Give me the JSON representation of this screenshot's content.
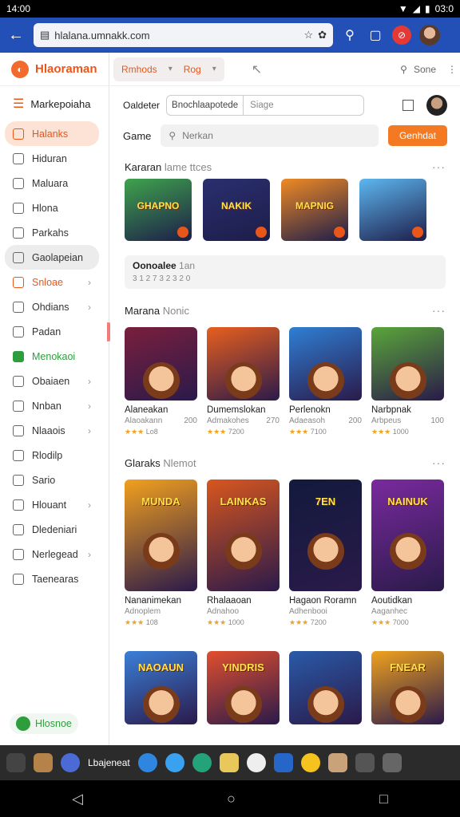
{
  "status": {
    "time": "14:00",
    "clock_right": "03:0"
  },
  "browser": {
    "url": "hlalana.umnakk.com"
  },
  "sidebar": {
    "brand": "Hlaoraman",
    "menu_label": "Markepoiaha",
    "items": [
      {
        "label": "Halanks",
        "style": "active"
      },
      {
        "label": "Hiduran",
        "style": ""
      },
      {
        "label": "Maluara",
        "style": ""
      },
      {
        "label": "Hlona",
        "style": ""
      },
      {
        "label": "Parkahs",
        "style": ""
      },
      {
        "label": "Gaolapeian",
        "style": "grey"
      },
      {
        "label": "Snloae",
        "style": "orange",
        "chev": true
      },
      {
        "label": "Ohdians",
        "style": "",
        "chev": true
      },
      {
        "label": "Padan",
        "style": ""
      },
      {
        "label": "Menokaoi",
        "style": "green"
      },
      {
        "label": "Obaiaen",
        "style": "",
        "chev": true
      },
      {
        "label": "Nnban",
        "style": "",
        "chev": true
      },
      {
        "label": "Nlaaois",
        "style": "",
        "chev": true
      },
      {
        "label": "Rlodilp",
        "style": ""
      },
      {
        "label": "Sario",
        "style": ""
      },
      {
        "label": "Hlouant",
        "style": "",
        "chev": true
      },
      {
        "label": "Dledeniari",
        "style": ""
      },
      {
        "label": "Nerlegead",
        "style": "",
        "chev": true
      },
      {
        "label": "Taenearas",
        "style": ""
      }
    ],
    "footer": "Hlosnoe"
  },
  "topbar": {
    "tab1": "Rmhods",
    "tab2": "Rog",
    "search_label": "Sone"
  },
  "filters": {
    "label": "Oaldeter",
    "seg1": "Bnochlaapotede",
    "seg2_placeholder": "Siage"
  },
  "game_row": {
    "label": "Game",
    "placeholder": "Nerkan",
    "button": "Genhdat"
  },
  "section1": {
    "title": "Kararan",
    "subtitle": "lame ttces",
    "tiles": [
      {
        "title": "GHAPNO",
        "bg": "#3fa34d"
      },
      {
        "title": "NAKIK",
        "bg": "#2a2f6e"
      },
      {
        "title": "MAPNIG",
        "bg": "#f08a24"
      },
      {
        "title": "",
        "bg": "#5db7f0"
      }
    ]
  },
  "notice": {
    "line1": "Oonoalee",
    "line1b": "1an",
    "line2": "3 1 2 7 3 2 3 2 0"
  },
  "section2": {
    "title": "Marana",
    "subtitle": "Nonic",
    "cards": [
      {
        "name": "Alaneakan",
        "dev": "Alaoakann",
        "num": "200",
        "rating": "★★★",
        "meta": "Lo8",
        "bg": "#7a1f3d"
      },
      {
        "name": "Dumemslokan",
        "dev": "Admakohes",
        "num": "270",
        "rating": "★★★",
        "meta": "7200",
        "bg": "#e85f1e"
      },
      {
        "name": "Perlenokn",
        "dev": "Adaeasoh",
        "num": "200",
        "rating": "★★★",
        "meta": "7100",
        "bg": "#2f7fd4"
      },
      {
        "name": "Narbpnak",
        "dev": "Arbpeus",
        "num": "100",
        "rating": "★★★",
        "meta": "1000",
        "bg": "#5aa63a"
      }
    ]
  },
  "section3": {
    "title": "Glaraks",
    "subtitle": "Nlemot",
    "cards": [
      {
        "name": "Nananimekan",
        "dev": "Adnoplem",
        "num": "",
        "rating": "★★★",
        "meta": "108",
        "art_title": "MUNDA",
        "bg": "#f2a01e"
      },
      {
        "name": "Rhalaaoan",
        "dev": "Adnahoo",
        "num": "",
        "rating": "★★★",
        "meta": "1000",
        "art_title": "LAINKAS",
        "bg": "#d8561e"
      },
      {
        "name": "Hagaon Roramn",
        "dev": "Adhenbooi",
        "num": "",
        "rating": "★★★",
        "meta": "7200",
        "art_title": "7EN",
        "bg": "#121a3d"
      },
      {
        "name": "Aoutidkan",
        "dev": "Aaganhec",
        "num": "",
        "rating": "★★★",
        "meta": "7000",
        "art_title": "NAINUK",
        "bg": "#7a2a9e"
      }
    ],
    "cards2": [
      {
        "art_title": "NAOAUN",
        "bg": "#3b7fd8"
      },
      {
        "art_title": "YINDRIS",
        "bg": "#e14f2e"
      },
      {
        "art_title": "",
        "bg": "#2a5aa8"
      },
      {
        "art_title": "FNEAR",
        "bg": "#f0a21e"
      }
    ]
  },
  "taskbar": {
    "label": "Lbajeneat"
  }
}
